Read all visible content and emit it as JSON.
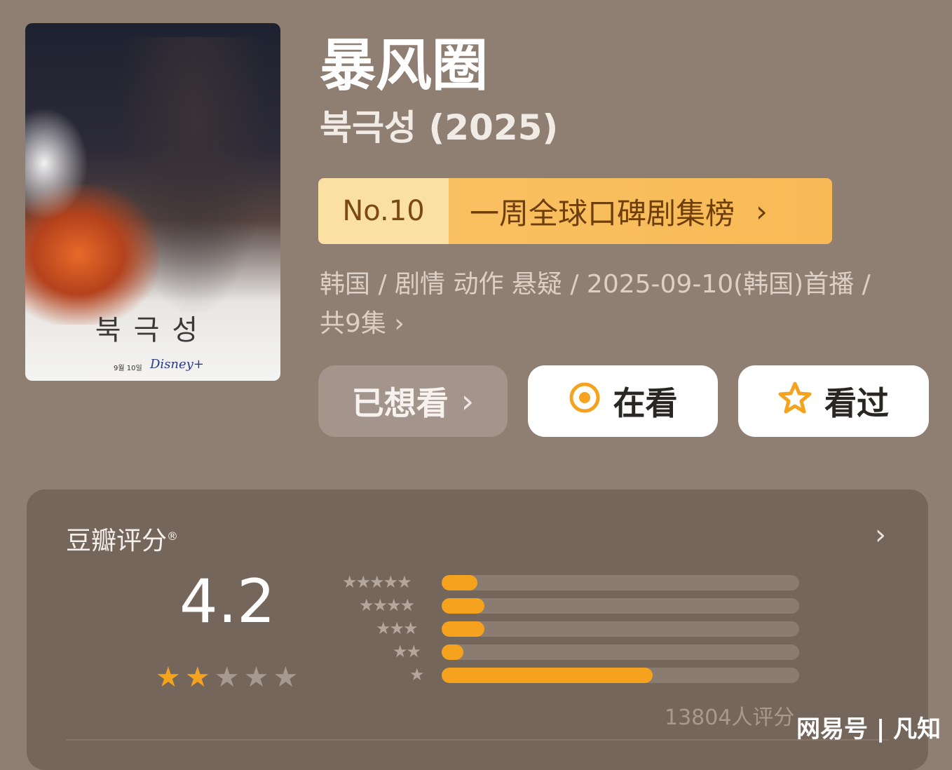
{
  "poster": {
    "title_ko": "북극성",
    "date": "9월 10일",
    "brand": "Disney+"
  },
  "header": {
    "title_cn": "暴风圈",
    "title_ko_year": "북극성 (2025)"
  },
  "rank": {
    "no": "No.10",
    "label": "一周全球口碑剧集榜",
    "arrow": "›"
  },
  "meta": {
    "line1": "韩国 / 剧情 动作 悬疑 / 2025-09-10(韩国)首播 /",
    "line2": "共9集 ›"
  },
  "buttons": {
    "want": "已想看",
    "want_arrow": "›",
    "watching": "在看",
    "watched": "看过"
  },
  "rating": {
    "title": "豆瓣评分",
    "reg_mark": "®",
    "arrow": "›",
    "score": "4.2",
    "score_stars": 2,
    "distribution": [
      {
        "stars": 5,
        "fraction": 0.1
      },
      {
        "stars": 4,
        "fraction": 0.12
      },
      {
        "stars": 3,
        "fraction": 0.12
      },
      {
        "stars": 2,
        "fraction": 0.06
      },
      {
        "stars": 1,
        "fraction": 0.59
      }
    ],
    "count_text": "13804人评分"
  },
  "watermark": "网易号 | 凡知",
  "colors": {
    "background": "#8f7e72",
    "accent": "#f5a21f",
    "rank_bg": "#f9c062"
  }
}
